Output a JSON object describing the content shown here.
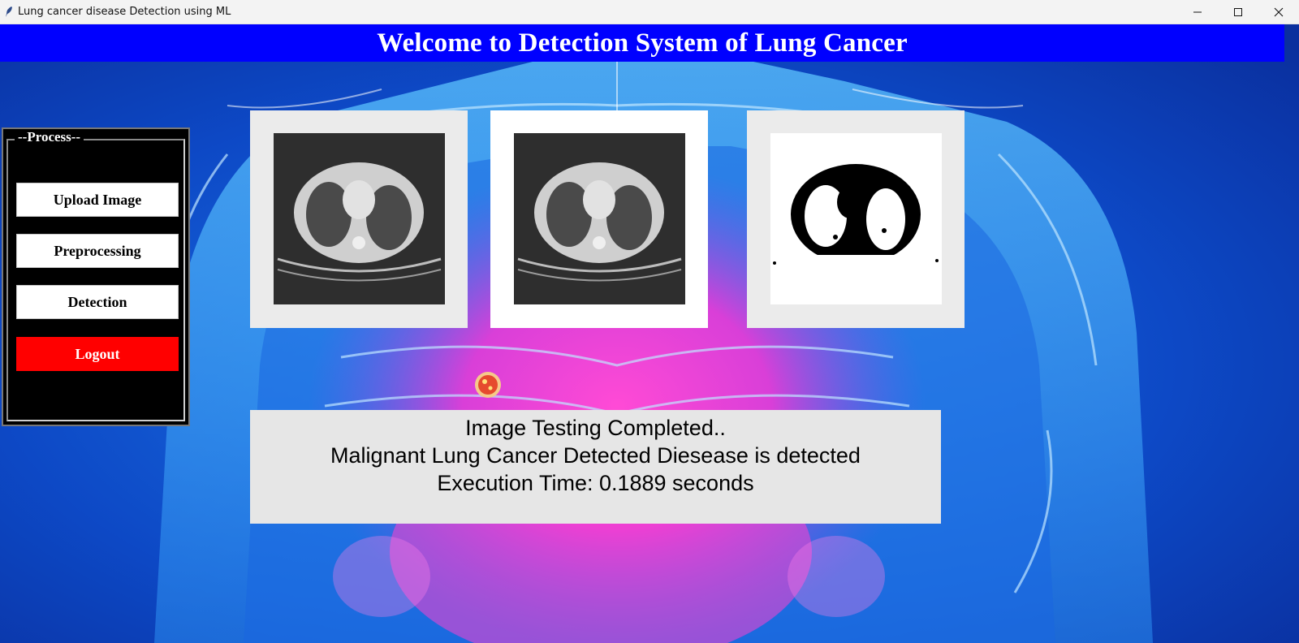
{
  "window": {
    "title": "Lung cancer disease Detection using ML",
    "icon": "feather-icon",
    "controls": [
      "minimize-icon",
      "maximize-icon",
      "close-icon"
    ]
  },
  "header": {
    "title": "Welcome to Detection System of Lung Cancer",
    "color": "#0000ff"
  },
  "process_panel": {
    "legend": "--Process--",
    "buttons": {
      "upload": "Upload Image",
      "preprocessing": "Preprocessing",
      "detection": "Detection",
      "logout": "Logout"
    },
    "logout_color": "#ff0000"
  },
  "images": [
    {
      "name": "original-ct-scan"
    },
    {
      "name": "preprocessed-ct-scan"
    },
    {
      "name": "segmented-binary-mask"
    }
  ],
  "result": {
    "line1": "Image Testing Completed..",
    "line2": "Malignant Lung Cancer Detected Diesease is detected",
    "line3": "Execution Time: 0.1889 seconds"
  }
}
